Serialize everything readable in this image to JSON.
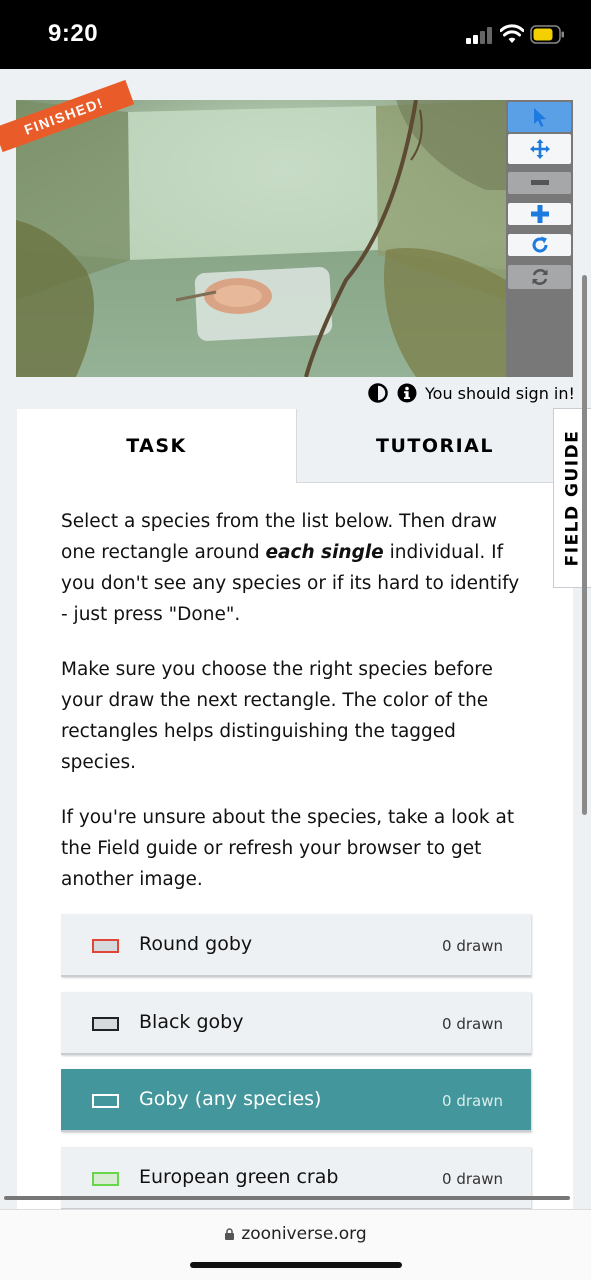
{
  "status_bar": {
    "time": "9:20"
  },
  "subject": {
    "banner": "FINISHED!"
  },
  "toolbar": {
    "tools": [
      {
        "icon": "pointer-icon",
        "active": true
      },
      {
        "icon": "move-icon"
      },
      {
        "icon": "zoom-out-icon",
        "disabled": true
      },
      {
        "icon": "zoom-in-icon"
      },
      {
        "icon": "rotate-icon"
      },
      {
        "icon": "reset-icon",
        "disabled": true
      }
    ]
  },
  "meta": {
    "sign_in": "You should sign in!"
  },
  "tabs": {
    "task": "TASK",
    "tutorial": "TUTORIAL"
  },
  "instructions": {
    "p1_before": "Select a species from the list below. Then draw one rectangle around ",
    "p1_emphasis": "each single",
    "p1_after": " individual. If you don't see any species or if its hard to identify - just press \"Done\".",
    "p2": "Make sure you choose the right species before your draw the next rectangle. The color of the rectangles helps distinguishing the tagged species.",
    "p3": "If you're unsure about the species, take a look at the Field guide or refresh your browser to get another image."
  },
  "species": [
    {
      "name": "Round goby",
      "count": "0 drawn",
      "color": "#e0453a",
      "selected": false
    },
    {
      "name": "Black goby",
      "count": "0 drawn",
      "color": "#222222",
      "selected": false
    },
    {
      "name": "Goby (any species)",
      "count": "0 drawn",
      "color": "#ffffff",
      "selected": true
    },
    {
      "name": "European green crab",
      "count": "0 drawn",
      "color": "#67d64a",
      "selected": false
    }
  ],
  "field_guide": {
    "label": "FIELD GUIDE"
  },
  "browser": {
    "url": "zooniverse.org"
  },
  "colors": {
    "accent": "#43979c",
    "banner": "#e95c2a",
    "tool_blue": "#1f7ae0"
  }
}
